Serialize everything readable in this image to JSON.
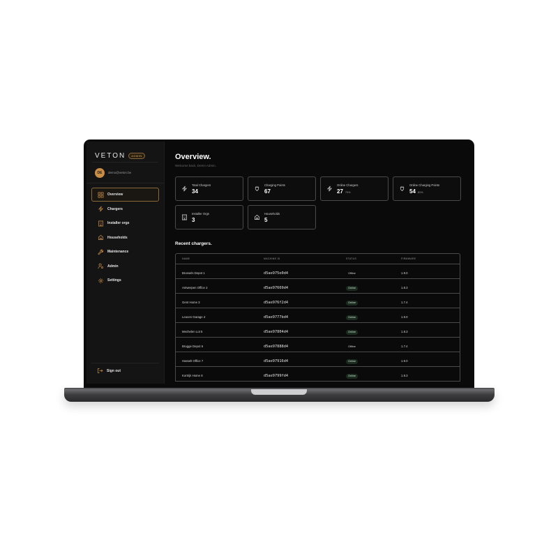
{
  "brand": {
    "name": "VETON",
    "badge": "ADMIN"
  },
  "user": {
    "initials": "DE",
    "email": "demo@veton.be"
  },
  "nav": {
    "items": [
      {
        "label": "Overview",
        "icon": "grid-icon",
        "active": true
      },
      {
        "label": "Chargers",
        "icon": "bolt-icon"
      },
      {
        "label": "Installer orgs",
        "icon": "building-icon"
      },
      {
        "label": "Households",
        "icon": "house-icon"
      },
      {
        "label": "Maintenance",
        "icon": "wrench-icon"
      },
      {
        "label": "Admin",
        "icon": "user-cog-icon"
      },
      {
        "label": "Settings",
        "icon": "gear-icon"
      }
    ],
    "signout": "Sign out"
  },
  "page": {
    "title": "Overview.",
    "subtitle": "Welcome back, Demo Admin."
  },
  "stats": [
    {
      "label": "Total Chargers",
      "value": "34",
      "pct": "",
      "icon": "bolt-icon"
    },
    {
      "label": "Charging Points",
      "value": "67",
      "pct": "",
      "icon": "plug-icon"
    },
    {
      "label": "Online Chargers",
      "value": "27",
      "pct": "79%",
      "icon": "bolt-icon"
    },
    {
      "label": "Online Charging Points",
      "value": "54",
      "pct": "81%",
      "icon": "plug-icon"
    },
    {
      "label": "Installer Orgs",
      "value": "3",
      "pct": "",
      "icon": "building-icon"
    },
    {
      "label": "Households",
      "value": "5",
      "pct": "",
      "icon": "house-icon"
    }
  ],
  "recent": {
    "title": "Recent chargers.",
    "columns": [
      "NAME",
      "MACHINE ID",
      "STATUS",
      "FIRMWARE"
    ],
    "rows": [
      {
        "name": "Brussels Depot 1",
        "machine_id": "d5ae975e0d4",
        "status": "Offline",
        "firmware": "1.9.0"
      },
      {
        "name": "Antwerpen Office 2",
        "machine_id": "d5ae97669d4",
        "status": "Online",
        "firmware": "1.8.3"
      },
      {
        "name": "Gent Home 3",
        "machine_id": "d5ae976f2d4",
        "status": "Online",
        "firmware": "1.7.4"
      },
      {
        "name": "Leuven Garage 4",
        "machine_id": "d5ae9777bd4",
        "status": "Online",
        "firmware": "1.9.0"
      },
      {
        "name": "Mechelen Lot 5",
        "machine_id": "d5ae97804d4",
        "status": "Online",
        "firmware": "1.8.3"
      },
      {
        "name": "Brugge Depot 6",
        "machine_id": "d5ae97888d4",
        "status": "Offline",
        "firmware": "1.7.4"
      },
      {
        "name": "Hasselt Office 7",
        "machine_id": "d5ae97916d4",
        "status": "Online",
        "firmware": "1.9.0"
      },
      {
        "name": "Kortrijk Home 8",
        "machine_id": "d5ae9799fd4",
        "status": "Online",
        "firmware": "1.8.3"
      }
    ]
  },
  "colors": {
    "accent": "#c98d45",
    "background": "#0a0a0a",
    "sidebar": "#141414",
    "online_bg": "#1c2b1f"
  }
}
